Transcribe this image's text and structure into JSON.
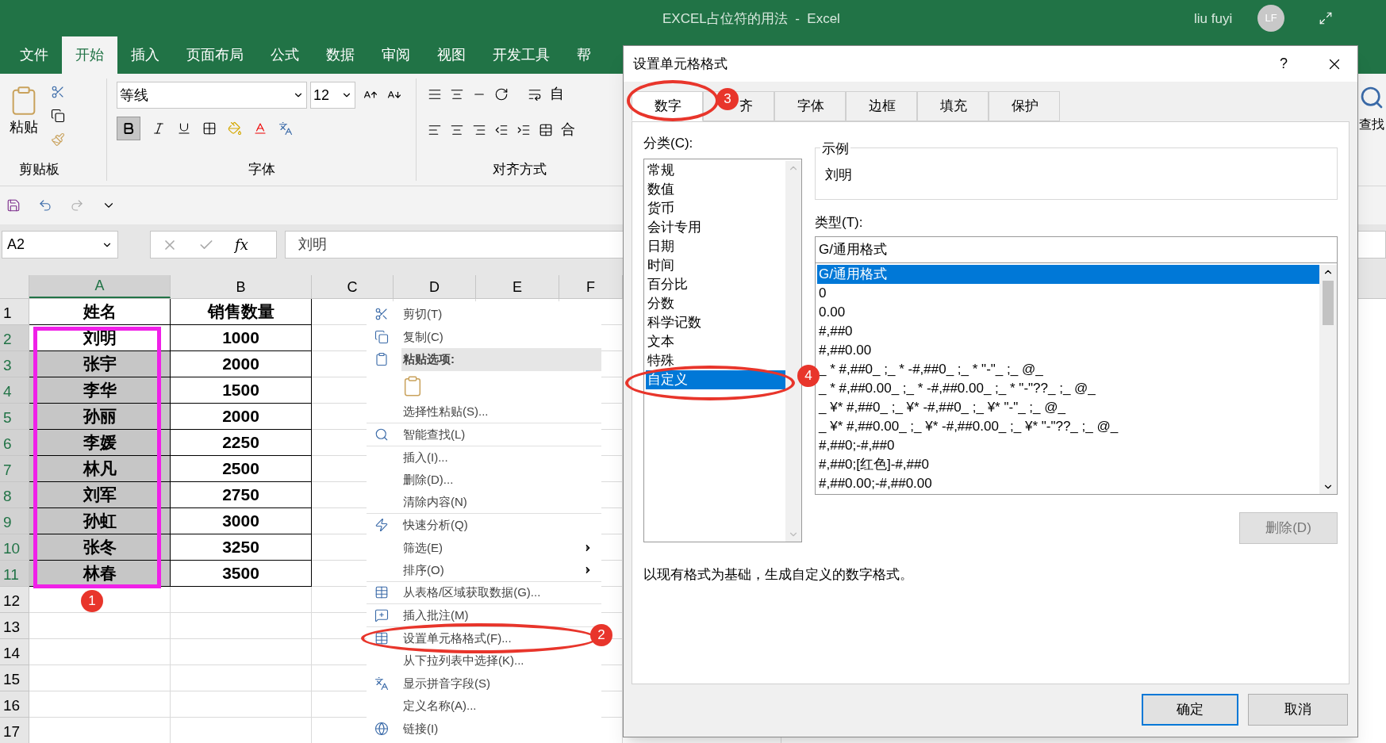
{
  "window": {
    "title": "EXCEL占位符的用法  -  Excel",
    "user": "liu fuyi",
    "avatar": "LF"
  },
  "ribbon_tabs": [
    {
      "label": "文件",
      "selected": false
    },
    {
      "label": "开始",
      "selected": true
    },
    {
      "label": "插入",
      "selected": false
    },
    {
      "label": "页面布局",
      "selected": false
    },
    {
      "label": "公式",
      "selected": false
    },
    {
      "label": "数据",
      "selected": false
    },
    {
      "label": "审阅",
      "selected": false
    },
    {
      "label": "视图",
      "selected": false
    },
    {
      "label": "开发工具",
      "selected": false
    },
    {
      "label": "帮",
      "selected": false
    }
  ],
  "ribbon": {
    "paste": "粘贴",
    "clipboard_group": "剪贴板",
    "font_name": "等线",
    "font_size": "12",
    "font_group": "字体",
    "wrap": "自",
    "merge": "合",
    "alignment_group": "对齐方式",
    "find": "查找"
  },
  "name_box": "A2",
  "formula_button": "fx",
  "formula": "刘明",
  "columns": [
    {
      "label": "A",
      "selected": true
    },
    {
      "label": "B",
      "selected": false
    },
    {
      "label": "C",
      "selected": false
    },
    {
      "label": "D",
      "selected": false
    },
    {
      "label": "E",
      "selected": false
    },
    {
      "label": "F",
      "selected": false
    }
  ],
  "rows": [
    {
      "number": "1",
      "selected": false,
      "cells": [
        "姓名",
        "销售数量"
      ]
    },
    {
      "number": "2",
      "selected": true,
      "active": true,
      "cells": [
        "刘明",
        "1000"
      ]
    },
    {
      "number": "3",
      "selected": true,
      "active": false,
      "cells": [
        "张宇",
        "2000"
      ]
    },
    {
      "number": "4",
      "selected": true,
      "active": false,
      "cells": [
        "李华",
        "1500"
      ]
    },
    {
      "number": "5",
      "selected": true,
      "active": false,
      "cells": [
        "孙丽",
        "2000"
      ]
    },
    {
      "number": "6",
      "selected": true,
      "active": false,
      "cells": [
        "李媛",
        "2250"
      ]
    },
    {
      "number": "7",
      "selected": true,
      "active": false,
      "cells": [
        "林凡",
        "2500"
      ]
    },
    {
      "number": "8",
      "selected": true,
      "active": false,
      "cells": [
        "刘军",
        "2750"
      ]
    },
    {
      "number": "9",
      "selected": true,
      "active": false,
      "cells": [
        "孙虹",
        "3000"
      ]
    },
    {
      "number": "10",
      "selected": true,
      "active": false,
      "cells": [
        "张冬",
        "3250"
      ]
    },
    {
      "number": "11",
      "selected": true,
      "active": false,
      "cells": [
        "林春",
        "3500"
      ]
    },
    {
      "number": "12",
      "selected": false
    },
    {
      "number": "13",
      "selected": false
    },
    {
      "number": "14",
      "selected": false
    },
    {
      "number": "15",
      "selected": false
    },
    {
      "number": "16",
      "selected": false
    },
    {
      "number": "17",
      "selected": false
    }
  ],
  "context_menu": [
    {
      "kind": "item",
      "label": "剪切(T)"
    },
    {
      "kind": "item",
      "label": "复制(C)"
    },
    {
      "kind": "header",
      "label": "粘贴选项:"
    },
    {
      "kind": "paste_options"
    },
    {
      "kind": "item",
      "label": "选择性粘贴(S)..."
    },
    {
      "kind": "item",
      "label": "智能查找(L)"
    },
    {
      "kind": "item",
      "label": "插入(I)..."
    },
    {
      "kind": "item",
      "label": "删除(D)..."
    },
    {
      "kind": "item",
      "label": "清除内容(N)"
    },
    {
      "kind": "item",
      "label": "快速分析(Q)"
    },
    {
      "kind": "submenu",
      "label": "筛选(E)"
    },
    {
      "kind": "submenu",
      "label": "排序(O)"
    },
    {
      "kind": "item",
      "label": "从表格/区域获取数据(G)..."
    },
    {
      "kind": "item",
      "label": "插入批注(M)"
    },
    {
      "kind": "item",
      "label": "设置单元格格式(F)..."
    },
    {
      "kind": "item",
      "label": "从下拉列表中选择(K)..."
    },
    {
      "kind": "item",
      "label": "显示拼音字段(S)"
    },
    {
      "kind": "item",
      "label": "定义名称(A)..."
    },
    {
      "kind": "item",
      "label": "链接(I)"
    }
  ],
  "dialog": {
    "title": "设置单元格格式",
    "help": "?",
    "tabs": [
      {
        "label": "数字",
        "selected": true
      },
      {
        "label": "齐",
        "selected": false
      },
      {
        "label": "字体",
        "selected": false
      },
      {
        "label": "边框",
        "selected": false
      },
      {
        "label": "填充",
        "selected": false
      },
      {
        "label": "保护",
        "selected": false
      }
    ],
    "category_label": "分类(C):",
    "categories": [
      {
        "label": "常规",
        "selected": false
      },
      {
        "label": "数值",
        "selected": false
      },
      {
        "label": "货币",
        "selected": false
      },
      {
        "label": "会计专用",
        "selected": false
      },
      {
        "label": "日期",
        "selected": false
      },
      {
        "label": "时间",
        "selected": false
      },
      {
        "label": "百分比",
        "selected": false
      },
      {
        "label": "分数",
        "selected": false
      },
      {
        "label": "科学记数",
        "selected": false
      },
      {
        "label": "文本",
        "selected": false
      },
      {
        "label": "特殊",
        "selected": false
      },
      {
        "label": "自定义",
        "selected": true
      }
    ],
    "sample_label": "示例",
    "sample_value": "刘明",
    "type_label": "类型(T):",
    "type_value": "G/通用格式",
    "formats": [
      {
        "label": "G/通用格式",
        "selected": true
      },
      {
        "label": "0",
        "selected": false
      },
      {
        "label": "0.00",
        "selected": false
      },
      {
        "label": "#,##0",
        "selected": false
      },
      {
        "label": "#,##0.00",
        "selected": false
      },
      {
        "label": "_ * #,##0_ ;_ * -#,##0_ ;_ * \"-\"_ ;_ @_",
        "selected": false
      },
      {
        "label": "_ * #,##0.00_ ;_ * -#,##0.00_ ;_ * \"-\"??_ ;_ @_",
        "selected": false
      },
      {
        "label": "_ ¥* #,##0_ ;_ ¥* -#,##0_ ;_ ¥* \"-\"_ ;_ @_",
        "selected": false
      },
      {
        "label": "_ ¥* #,##0.00_ ;_ ¥* -#,##0.00_ ;_ ¥* \"-\"??_ ;_ @_",
        "selected": false
      },
      {
        "label": "#,##0;-#,##0",
        "selected": false
      },
      {
        "label": "#,##0;[红色]-#,##0",
        "selected": false
      },
      {
        "label": "#,##0.00;-#,##0.00",
        "selected": false
      }
    ],
    "delete_button": {
      "label": "删除(D)",
      "disabled": true
    },
    "description": "以现有格式为基础，生成自定义的数字格式。",
    "ok": "确定",
    "cancel": "取消"
  },
  "annotations": [
    {
      "label": "1"
    },
    {
      "label": "2"
    },
    {
      "label": "3"
    },
    {
      "label": "4"
    }
  ]
}
